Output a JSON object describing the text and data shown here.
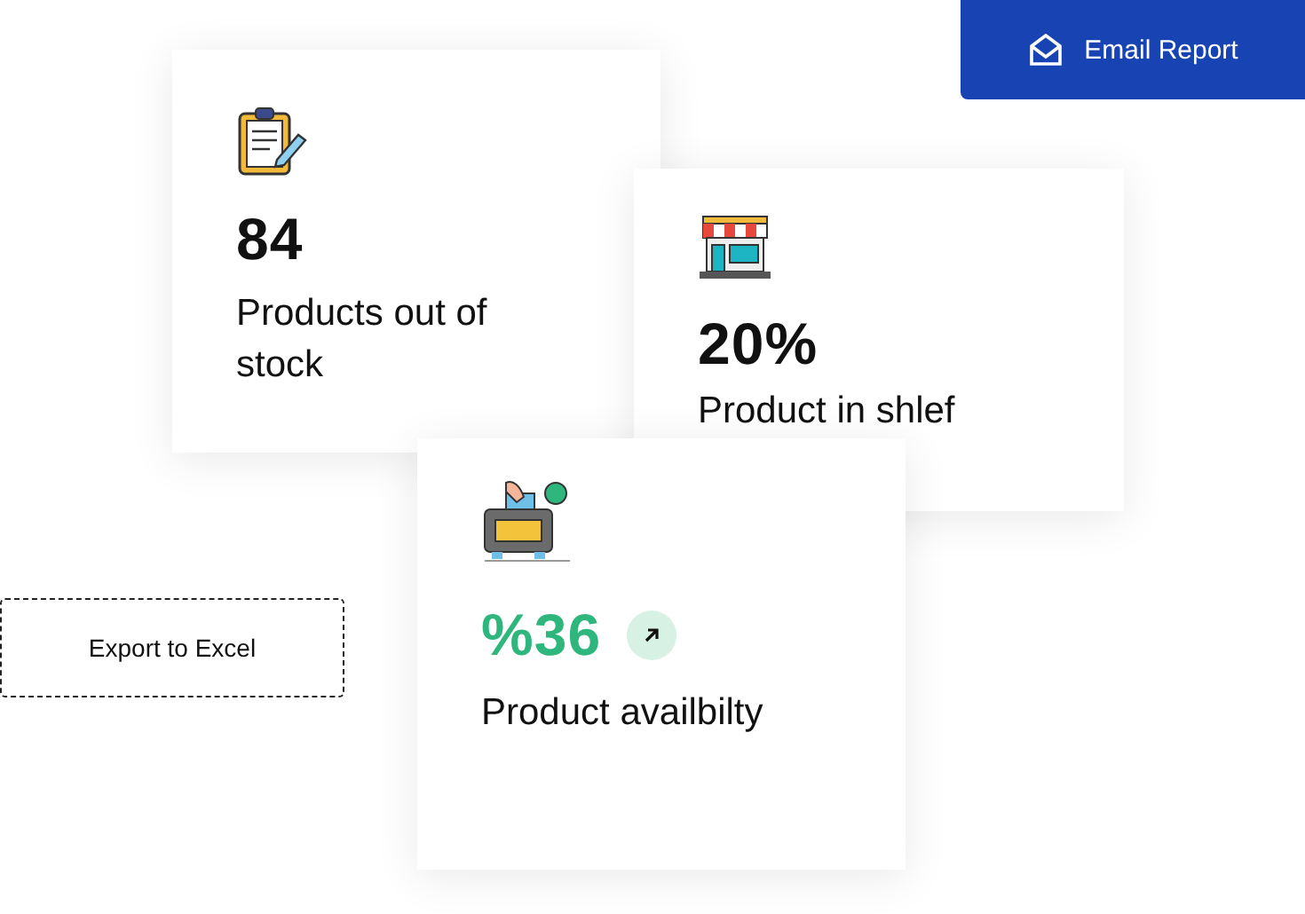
{
  "email_button": {
    "label": "Email Report"
  },
  "export_button": {
    "label": "Export to Excel"
  },
  "cards": [
    {
      "kind": "clipboard",
      "value": "84",
      "label": "Products out of stock"
    },
    {
      "kind": "shop",
      "value": "20%",
      "label": "Product in shlef"
    },
    {
      "kind": "register",
      "value": "%36",
      "label": "Product availbilty",
      "trending_up": true
    }
  ]
}
